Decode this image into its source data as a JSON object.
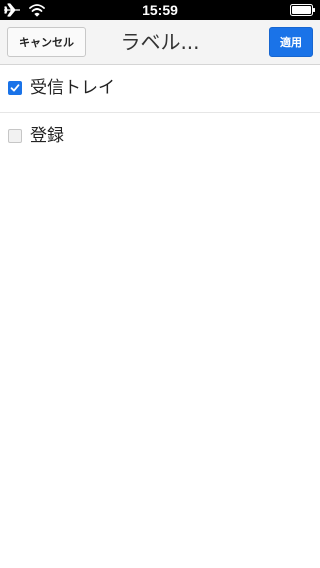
{
  "status_bar": {
    "time": "15:59",
    "icons": [
      "airplane-icon",
      "wifi-icon",
      "battery-icon"
    ]
  },
  "header": {
    "cancel_label": "キャンセル",
    "title": "ラベル...",
    "apply_label": "適用"
  },
  "labels": [
    {
      "name": "受信トレイ",
      "checked": true
    },
    {
      "name": "登録",
      "checked": false
    }
  ],
  "colors": {
    "accent": "#1a73e8",
    "header_bg": "#f4f4f4",
    "status_bar_bg": "#000000"
  }
}
